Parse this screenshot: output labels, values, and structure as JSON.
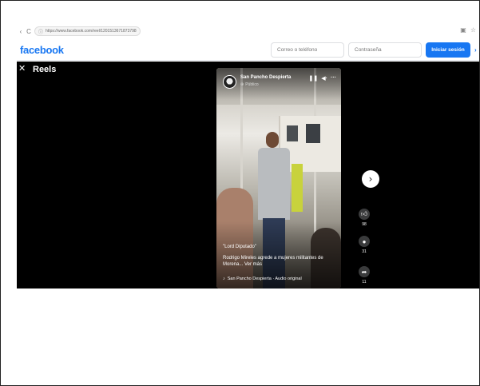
{
  "browser": {
    "url": "https://www.facebook.com/reel/1201513671873798",
    "back_icon": "arrow-left-icon",
    "reload_glyph": "C",
    "site_info_icon": "page-info-icon"
  },
  "header": {
    "logo": "facebook",
    "email_placeholder": "Correo o teléfono",
    "password_placeholder": "Contraseña",
    "login_label": "Iniciar sesión"
  },
  "reels": {
    "title": "Reels",
    "channel": {
      "name": "San Pancho Despierta",
      "visibility": "Público"
    },
    "caption": {
      "title": "\"Lord Diputado\"",
      "text": "Rodrigo Mireles agrede a mujeres militantes de Morena... Ver más",
      "audio": "San Pancho Despierta · Audio original"
    },
    "actions": {
      "likes": "98",
      "comments": "31",
      "shares": "11"
    }
  },
  "colors": {
    "brand": "#1877f2",
    "stage_background": "#000000"
  }
}
